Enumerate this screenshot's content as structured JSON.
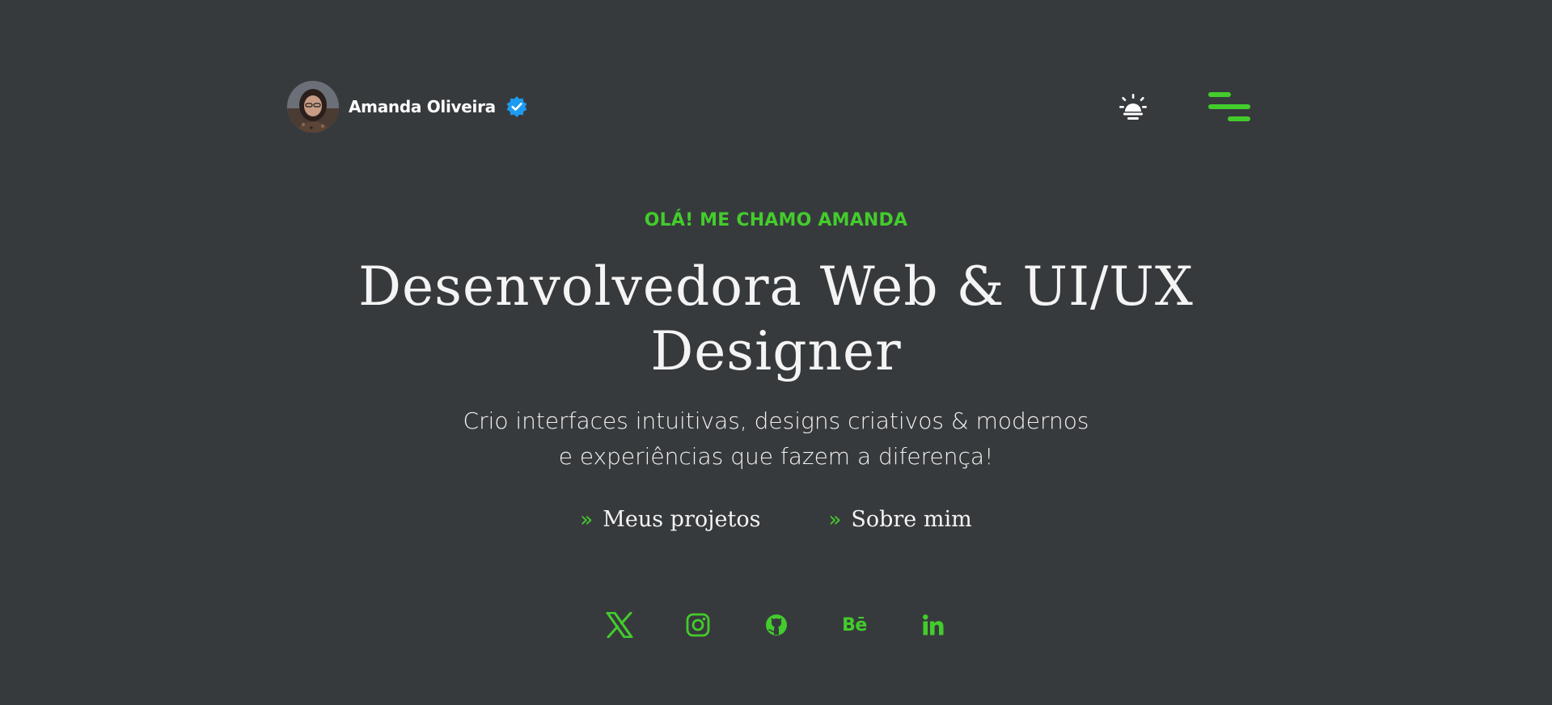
{
  "header": {
    "name": "Amanda Oliveira",
    "avatar_icon": "profile-photo",
    "verified_icon": "verified-badge-icon",
    "theme_toggle_icon": "sun-icon",
    "menu_icon": "menu-lines-icon"
  },
  "hero": {
    "eyebrow": "OLÁ! ME CHAMO AMANDA",
    "headline": "Desenvolvedora Web & UI/UX Designer",
    "subtitle": "Crio interfaces intuitivas, designs criativos & modernos e experiências que fazem a diferença!",
    "cta_projects": "Meus projetos",
    "cta_about": "Sobre mim",
    "cta_arrow": "»"
  },
  "social": {
    "items": [
      {
        "icon": "x-icon"
      },
      {
        "icon": "instagram-icon"
      },
      {
        "icon": "github-icon"
      },
      {
        "icon": "behance-icon",
        "label": "Bē"
      },
      {
        "icon": "linkedin-icon"
      }
    ]
  },
  "colors": {
    "background": "#373a3d",
    "accent": "#43cc2c",
    "verified": "#1d9bf0",
    "text": "#f4f4f4"
  }
}
